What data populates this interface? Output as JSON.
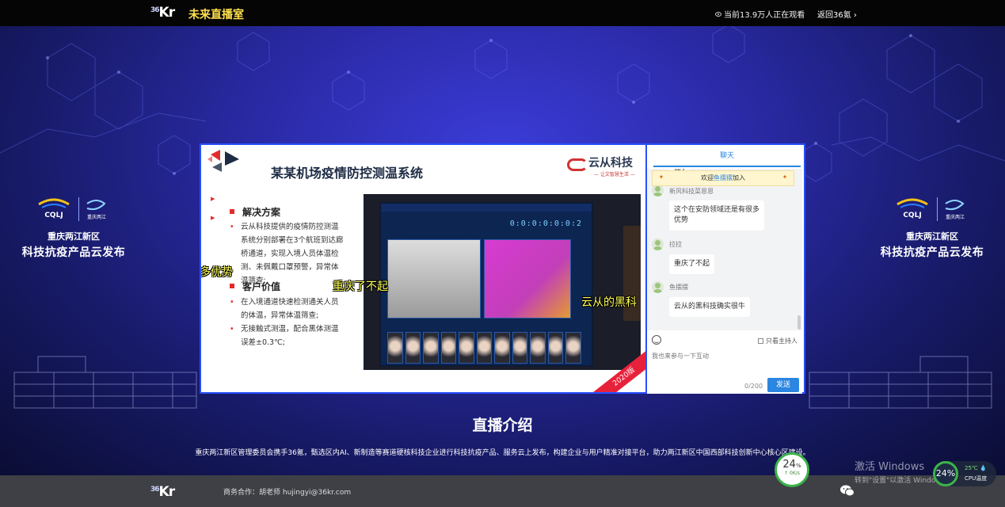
{
  "header": {
    "logo_prefix": "36",
    "logo_text": "Kr",
    "title": "未来直播室",
    "viewers": "当前13.9万人正在观看",
    "back_link": "返回36氪 ›"
  },
  "side_brand": {
    "logo_text": "CQLJ",
    "logo_sub": "重庆·两江新区",
    "logo2_text": "重庆两江",
    "line1": "重庆两江新区",
    "line2": "科技抗疫产品云发布"
  },
  "slide": {
    "title": "某某机场疫情防控测温系统",
    "company": "云从科技",
    "company_tag": "— 让文智慧生活 —",
    "sections": [
      {
        "heading": "解决方案",
        "bullets": [
          "云从科技提供的疫情防控测温系统分别部署在3个航班到达廊桥通道，实现入境人员体温检测、未佩戴口罩预警，异常体温筛查;"
        ]
      },
      {
        "heading": "客户价值",
        "bullets": [
          "在入境通道快速检测通关人员的体温，异常体温筛查;",
          "无接触式测温，配合黑体测温误差±0.3℃;"
        ]
      }
    ],
    "photo_digits": "0:0:0:0:0:0:2",
    "corner_band": "2020版"
  },
  "danmu": [
    "多优势",
    "重庆了不起",
    "云从的黑科"
  ],
  "chat": {
    "tab": "聊天",
    "welcome_prefix": "欢迎",
    "welcome_name": "鱼摆摆",
    "welcome_suffix": "加入",
    "partial_top": "搜?",
    "partial_name": "新风科技菜恩恩",
    "messages": [
      {
        "name": "",
        "text": "这个在安防领域还是有很多优势"
      },
      {
        "name": "拉拉",
        "text": "重庆了不起"
      },
      {
        "name": "鱼摆摆",
        "text": "云从的黑科技确实很牛"
      }
    ],
    "host_only": "只看主持人",
    "input_placeholder": "我也来参与一下互动",
    "counter": "0/200",
    "send": "发送"
  },
  "intro": {
    "title": "直播介绍",
    "desc": "重庆两江新区管理委员会携手36氪，甄选区内AI、新制造等赛道硬核科技企业进行科技抗疫产品、服务云上发布，构建企业与用户精准对接平台，助力两江新区中国西部科技创新中心核心区建设。"
  },
  "footer": {
    "contact": "商务合作：胡老师 hujingyi@36kr.com"
  },
  "overlay": {
    "gauge1_pct": "24",
    "gauge1_unit": "%",
    "gauge1_net": "↑ 0K/s",
    "gauge2_pct": "24%",
    "temp": "25℃ 💧",
    "cpu": "CPU温度",
    "win_line1": "激活 Windows",
    "win_line2": "转到\"设置\"以激活 Windows。"
  }
}
